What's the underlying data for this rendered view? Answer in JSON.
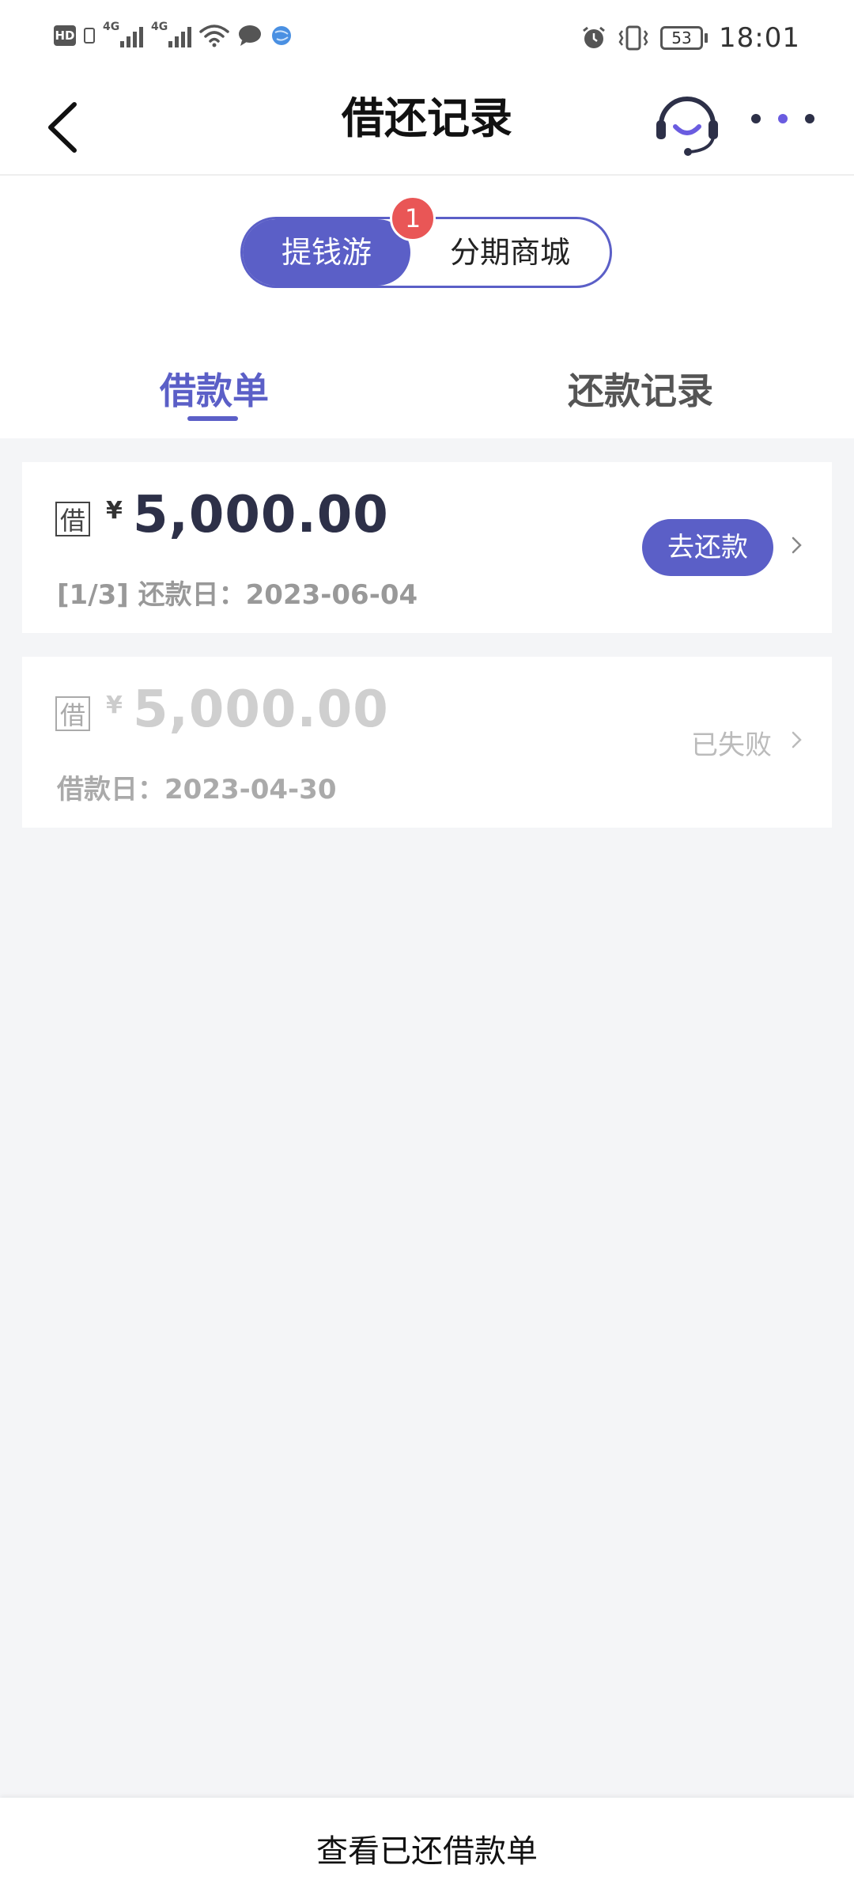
{
  "status_bar": {
    "hd_label": "HD",
    "sim1_label": "4G",
    "sim2_label": "4G",
    "battery_level": "53",
    "time": "18:01"
  },
  "header": {
    "title": "借还记录"
  },
  "segment": {
    "options": [
      "提钱游",
      "分期商城"
    ],
    "active_index": 0,
    "badge_count": "1"
  },
  "tabs": {
    "items": [
      "借款单",
      "还款记录"
    ],
    "active_index": 0
  },
  "loans": [
    {
      "tag": "借",
      "currency": "¥",
      "amount": "5,000.00",
      "subtitle": "[1/3] 还款日：2023-06-04",
      "action_label": "去还款",
      "status": ""
    },
    {
      "tag": "借",
      "currency": "¥",
      "amount": "5,000.00",
      "subtitle": "借款日：2023-04-30",
      "action_label": "",
      "status": "已失败"
    }
  ],
  "bottom_bar": {
    "label": "查看已还借款单"
  },
  "colors": {
    "accent": "#5b5fc7",
    "badge": "#e95656",
    "background": "#f4f5f7"
  }
}
